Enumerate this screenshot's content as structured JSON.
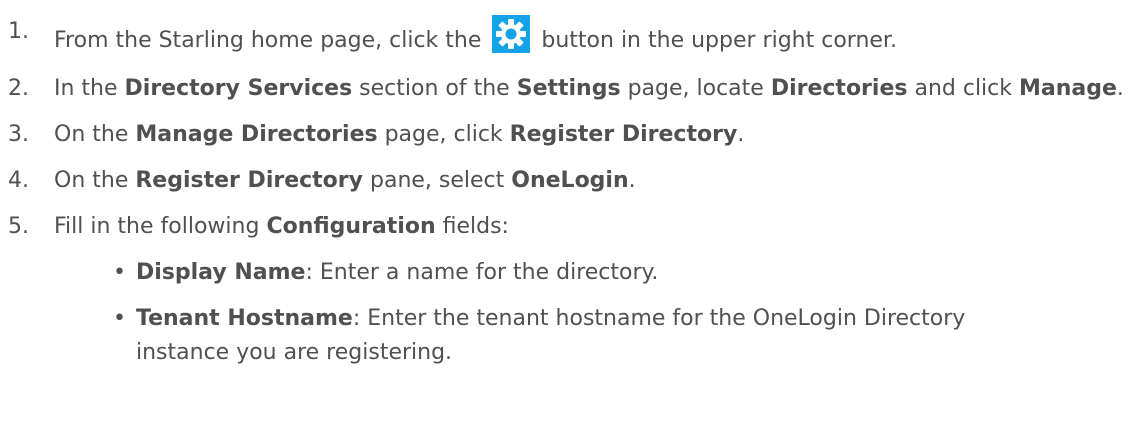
{
  "steps": [
    {
      "num": "1.",
      "pre": "From the Starling home page, click the",
      "icon": "gear-icon",
      "post": "button in the upper right corner."
    },
    {
      "num": "2.",
      "t1": "In the ",
      "b1": "Directory Services",
      "t2": " section of the ",
      "b2": "Settings",
      "t3": " page, locate ",
      "b3": "Directories",
      "t4": " and click ",
      "b4": "Manage",
      "t5": "."
    },
    {
      "num": "3.",
      "t1": "On the ",
      "b1": "Manage Directories",
      "t2": " page, click ",
      "b2": "Register Directory",
      "t3": "."
    },
    {
      "num": "4.",
      "t1": "On the ",
      "b1": "Register Directory",
      "t2": " pane, select ",
      "b2": "OneLogin",
      "t3": "."
    },
    {
      "num": "5.",
      "t1": "Fill in the following ",
      "b1": "Configuration",
      "t2": " fields:"
    }
  ],
  "bullets": [
    {
      "mark": "•",
      "b": "Display Name",
      "t": ": Enter a name for the directory."
    },
    {
      "mark": "•",
      "b": "Tenant Hostname",
      "t": ": Enter the tenant hostname for the OneLogin Directory instance you are registering."
    }
  ],
  "colors": {
    "text": "#505050",
    "button_bg": "#13a3e6"
  }
}
